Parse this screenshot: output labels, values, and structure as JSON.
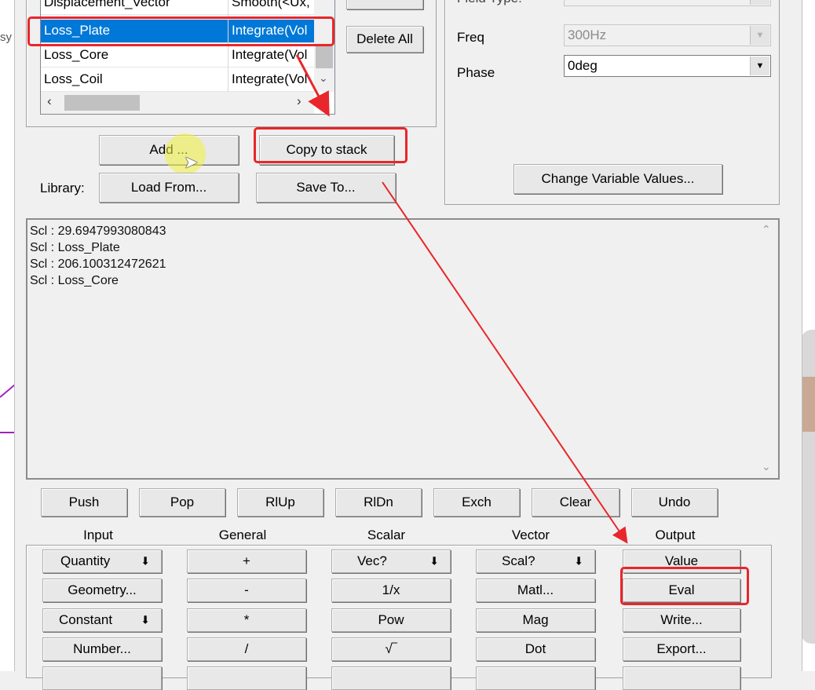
{
  "expression_list": {
    "rows": [
      {
        "name": "Displacement_Vector",
        "expr": "Smooth(<Ux,"
      },
      {
        "name": "Loss_Plate",
        "expr": "Integrate(Vol",
        "selected": true
      },
      {
        "name": "Loss_Core",
        "expr": "Integrate(Vol"
      },
      {
        "name": "Loss_Coil",
        "expr": "Integrate(Vol"
      }
    ]
  },
  "list_buttons": {
    "delete_all": "Delete All"
  },
  "field_panel": {
    "field_type_label": "Field Type:",
    "freq_label": "Freq",
    "freq_value": "300Hz",
    "phase_label": "Phase",
    "phase_value": "0deg",
    "change_variables": "Change Variable Values..."
  },
  "actions": {
    "add": "Add ...",
    "copy_to_stack": "Copy to stack",
    "library_label": "Library:",
    "load_from": "Load From...",
    "save_to": "Save To..."
  },
  "stack": {
    "lines": [
      "Scl : 29.6947993080843",
      "Scl : Loss_Plate",
      "Scl : 206.100312472621",
      "Scl : Loss_Core"
    ]
  },
  "stack_buttons": [
    "Push",
    "Pop",
    "RlUp",
    "RlDn",
    "Exch",
    "Clear",
    "Undo"
  ],
  "sections": {
    "input": {
      "title": "Input",
      "buttons": [
        "Quantity",
        "Geometry...",
        "Constant",
        "Number..."
      ]
    },
    "general": {
      "title": "General",
      "buttons": [
        "+",
        "-",
        "*",
        "/"
      ]
    },
    "scalar": {
      "title": "Scalar",
      "buttons": [
        "Vec?",
        "1/x",
        "Pow",
        "√‾"
      ]
    },
    "vector": {
      "title": "Vector",
      "buttons": [
        "Scal?",
        "Matl...",
        "Mag",
        "Dot"
      ]
    },
    "output": {
      "title": "Output",
      "buttons": [
        "Value",
        "Eval",
        "Write...",
        "Export..."
      ]
    }
  },
  "side_label": "sy",
  "colors": {
    "annotation": "#e8262b",
    "selection": "#0078d7"
  }
}
